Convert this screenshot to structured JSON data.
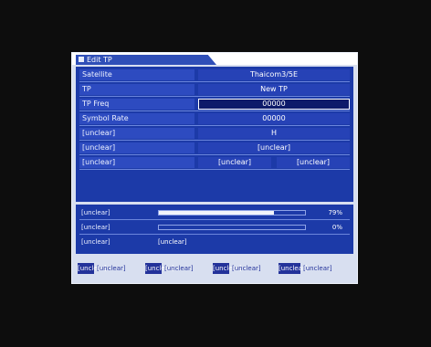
{
  "menu": {
    "title": "Edit TP"
  },
  "fields": [
    {
      "label": "Satellite",
      "value": "Thaicom3/5E"
    },
    {
      "label": "TP",
      "value": "New TP"
    },
    {
      "label": "TP Freq",
      "value": "00000"
    },
    {
      "label": "Symbol Rate",
      "value": "00000"
    },
    {
      "label": "[unclear]",
      "value": "H"
    },
    {
      "label": "[unclear]",
      "value": "[unclear]"
    }
  ],
  "search_row": {
    "label": "[unclear]",
    "options": [
      "[unclear]",
      "[unclear]"
    ]
  },
  "status": {
    "quality": {
      "label": "[unclear]",
      "percent": 79,
      "text": "79%"
    },
    "level": {
      "label": "[unclear]",
      "percent": 0,
      "text": "0%"
    },
    "state": {
      "label": "[unclear]",
      "text": "[unclear]"
    }
  },
  "help": [
    {
      "key": "[unclear]",
      "text": "[unclear]"
    },
    {
      "key": "[unclear]",
      "text": "[unclear]"
    },
    {
      "key": "[unclear]",
      "text": "[unclear]"
    },
    {
      "key": "[unclear]",
      "text": "[unclear]"
    }
  ]
}
